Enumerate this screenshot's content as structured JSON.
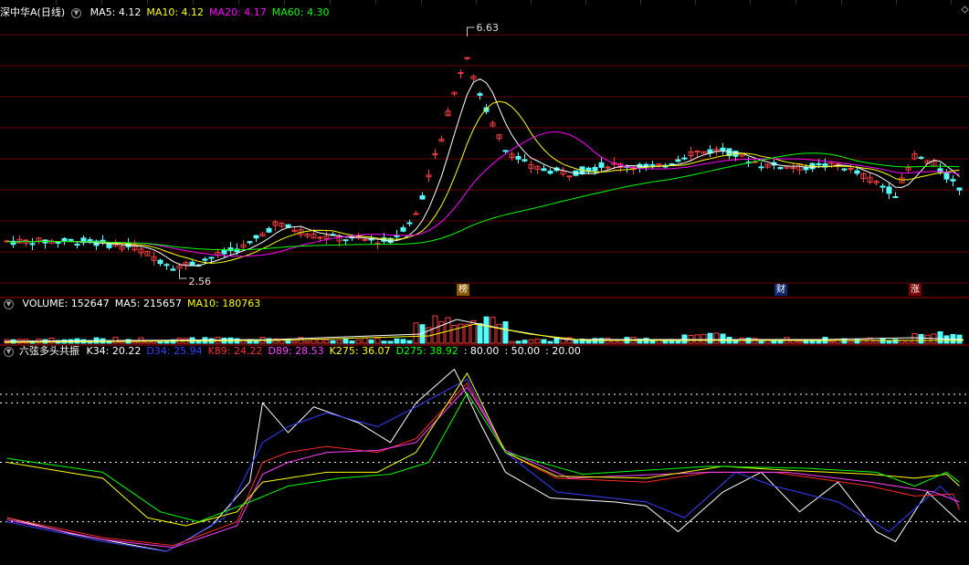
{
  "colors": {
    "background": "#000000",
    "up": "#ff3c3c",
    "down": "#54fcfc",
    "ma5": "#ffffff",
    "ma10": "#ffff00",
    "ma20": "#ff00ff",
    "ma60": "#00ff00",
    "k34": "#ffffff",
    "d34": "#3040ff",
    "k89": "#ff2a2a",
    "d89": "#ff40ff",
    "k275": "#ffff00",
    "d275": "#00ff00",
    "divider": "#b00000",
    "dotted": "#ffffff"
  },
  "price_panel": {
    "title": "深中华A(日线)",
    "indicators": [
      {
        "label": "MA5:",
        "value": "4.12",
        "color": "#ffffff"
      },
      {
        "label": "MA10:",
        "value": "4.12",
        "color": "#ffff00"
      },
      {
        "label": "MA20:",
        "value": "4.17",
        "color": "#ff00ff"
      },
      {
        "label": "MA60:",
        "value": "4.30",
        "color": "#00ff00"
      }
    ],
    "high_label": "6.63",
    "low_label": "2.56",
    "markers": [
      {
        "text": "榜",
        "bg": "#8a5a00"
      },
      {
        "text": "财",
        "bg": "#102a70"
      },
      {
        "text": "涨",
        "bg": "#7a0000"
      }
    ]
  },
  "volume_panel": {
    "indicators": [
      {
        "label": "VOLUME:",
        "value": "152647",
        "color": "#ffffff"
      },
      {
        "label": "MA5:",
        "value": "215657",
        "color": "#ffffff"
      },
      {
        "label": "MA10:",
        "value": "180763",
        "color": "#ffff00"
      }
    ]
  },
  "osc_panel": {
    "title": "六弦多头共振",
    "indicators": [
      {
        "label": "K34:",
        "value": "20.22",
        "color": "#ffffff"
      },
      {
        "label": "D34:",
        "value": "25.94",
        "color": "#3040ff"
      },
      {
        "label": "K89:",
        "value": "24.22",
        "color": "#ff2a2a"
      },
      {
        "label": "D89:",
        "value": "28.53",
        "color": "#ff40ff"
      },
      {
        "label": "K275:",
        "value": "36.07",
        "color": "#ffff00"
      },
      {
        "label": "D275:",
        "value": "38.92",
        "color": "#00ff00"
      },
      {
        "label": ":",
        "value": "80.00",
        "color": "#ffffff"
      },
      {
        "label": ":",
        "value": "50.00",
        "color": "#ffffff"
      },
      {
        "label": ":",
        "value": "20.00",
        "color": "#ffffff"
      }
    ],
    "levels": [
      80,
      50,
      20
    ]
  }
}
